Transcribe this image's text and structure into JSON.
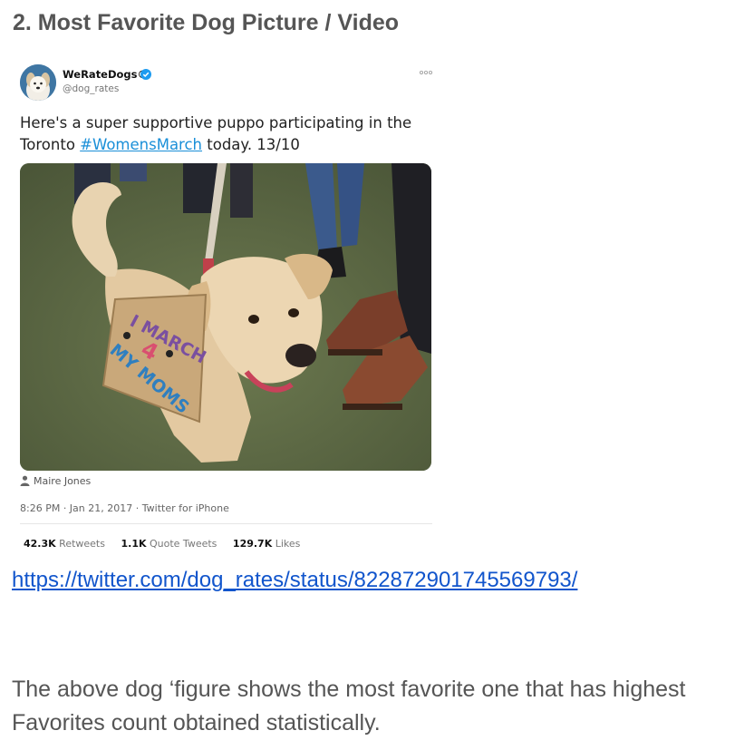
{
  "heading": "2. Most Favorite Dog Picture / Video",
  "tweet": {
    "user_name": "WeRateDogs®",
    "handle": "@dog_rates",
    "text_before": "Here's a super supportive puppo participating in the Toronto ",
    "hashtag": "#WomensMarch",
    "text_after": " today. 13/10",
    "sign_text": "I MARCH 4 MY MOMS",
    "photo_credit": "Maire Jones",
    "meta": "8:26 PM · Jan 21, 2017 · Twitter for iPhone",
    "stats": [
      {
        "value": "42.3K",
        "label": "Retweets"
      },
      {
        "value": "1.1K",
        "label": "Quote Tweets"
      },
      {
        "value": "129.7K",
        "label": "Likes"
      }
    ]
  },
  "link": "https://twitter.com/dog_rates/status/822872901745569793/",
  "caption": "The above dog ‘figure shows the most favorite one that has highest Favorites count obtained statistically.",
  "colors": {
    "link": "#1155cc",
    "hashtag": "#1a8fd8",
    "verified": "#1d9bf0",
    "text": "#555555"
  },
  "icons": [
    "verified-badge-icon",
    "more-options-icon",
    "person-icon"
  ]
}
